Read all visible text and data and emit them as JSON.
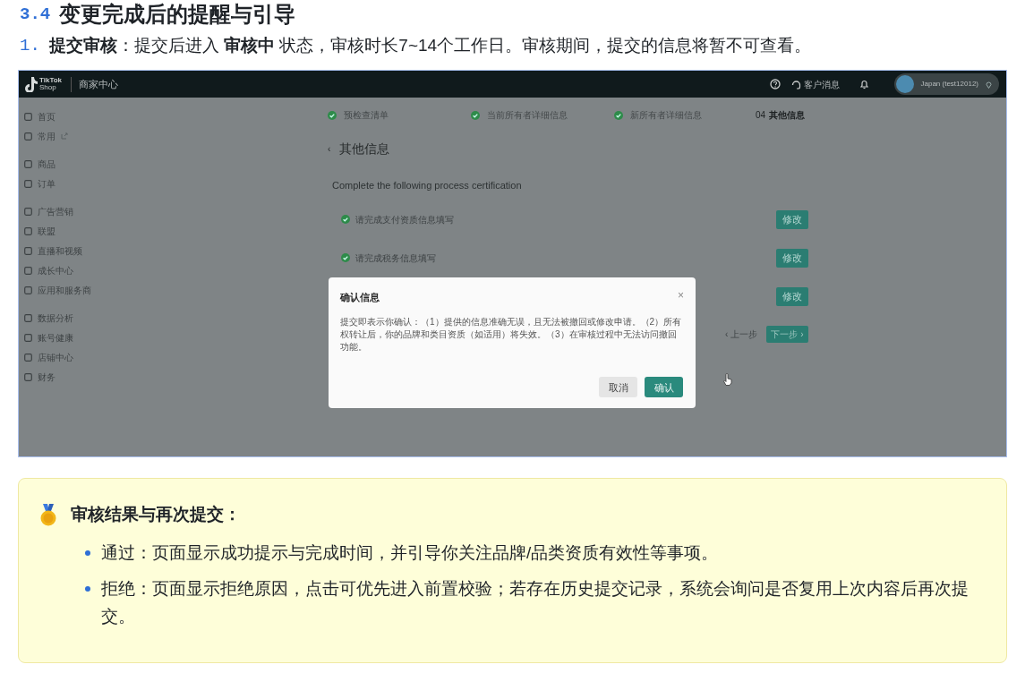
{
  "heading": {
    "number": "3.4",
    "title": "变更完成后的提醒与引导"
  },
  "steps": [
    {
      "number": "1.",
      "text": "**提交审核**：提交后进入 **审核中** 状态，审核时长7~14个工作日。审核期间，提交的信息将暂不可查看。"
    }
  ],
  "screenshot": {
    "topbar": {
      "logo_line1": "TikTok",
      "logo_line2": "Shop",
      "title": "商家中心",
      "messages": "客户消息",
      "account": "Japan (test12012)"
    },
    "sidebar": {
      "groups": [
        [
          {
            "label": "首页",
            "external_link": false
          },
          {
            "label": "常用",
            "external_link": true
          }
        ],
        [
          {
            "label": "商品",
            "external_link": false
          },
          {
            "label": "订单",
            "external_link": false
          }
        ],
        [
          {
            "label": "广告营销",
            "external_link": false
          },
          {
            "label": "联盟",
            "external_link": false
          },
          {
            "label": "直播和视频",
            "external_link": false
          },
          {
            "label": "成长中心",
            "external_link": false
          },
          {
            "label": "应用和服务商",
            "external_link": false
          }
        ],
        [
          {
            "label": "数据分析",
            "external_link": false
          },
          {
            "label": "账号健康",
            "external_link": false
          },
          {
            "label": "店铺中心",
            "external_link": false
          },
          {
            "label": "财务",
            "external_link": false
          }
        ]
      ]
    },
    "stepper": [
      {
        "label": "预检查清单",
        "done": true
      },
      {
        "label": "当前所有者详细信息",
        "done": true
      },
      {
        "label": "新所有者详细信息",
        "done": true
      },
      {
        "number": "04",
        "label": "其他信息",
        "done": false
      }
    ],
    "back": "‹",
    "page_title": "其他信息",
    "section_title": "Complete the following process certification",
    "tasks": [
      {
        "label": "请完成支付资质信息填写",
        "done": true,
        "button": "修改"
      },
      {
        "label": "请完成税务信息填写",
        "done": true,
        "button": "修改"
      },
      {
        "button": "修改"
      }
    ],
    "previous": "‹ 上一步",
    "next": "下一步 ›",
    "dialog": {
      "title": "确认信息",
      "close": "×",
      "body": "提交即表示你确认：（1）提供的信息准确无误，且无法被撤回或修改申请。（2）所有权转让后，你的品牌和类目资质（如适用）将失效。（3）在审核过程中无法访问撤回功能。",
      "cancel": "取消",
      "confirm": "确认"
    }
  },
  "callout": {
    "title": "审核结果与再次提交：",
    "items": [
      "通过：页面显示成功提示与完成时间，并引导你关注品牌/品类资质有效性等事项。",
      "拒绝：页面显示拒绝原因，点击可优先进入前置校验；若存在历史提交记录，系统会询问是否复用上次内容后再次提交。"
    ]
  }
}
